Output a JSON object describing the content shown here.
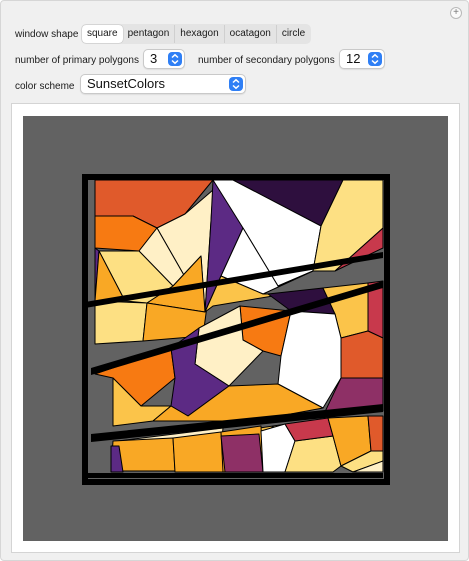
{
  "controls": {
    "window_shape_label": "window shape",
    "window_shape_options": [
      "square",
      "pentagon",
      "hexagon",
      "ocatagon",
      "circle"
    ],
    "window_shape_selected": "square",
    "primary_label": "number of primary polygons",
    "primary_value": "3",
    "secondary_label": "number of secondary polygons",
    "secondary_value": "12",
    "color_scheme_label": "color scheme",
    "color_scheme_value": "SunsetColors"
  },
  "icons": {
    "add": "plus-icon",
    "stepper": "up-down-chevron-icon"
  },
  "colors": {
    "canvas_background": "#626262",
    "frame": "#000000",
    "select_accent": "#2f7ff5",
    "palette": [
      "#2e0f3e",
      "#5c2a84",
      "#8e3066",
      "#c8394c",
      "#e05a2b",
      "#f77a12",
      "#f9a825",
      "#fbc44a",
      "#fde083",
      "#fff0c6",
      "#ffffff"
    ]
  }
}
